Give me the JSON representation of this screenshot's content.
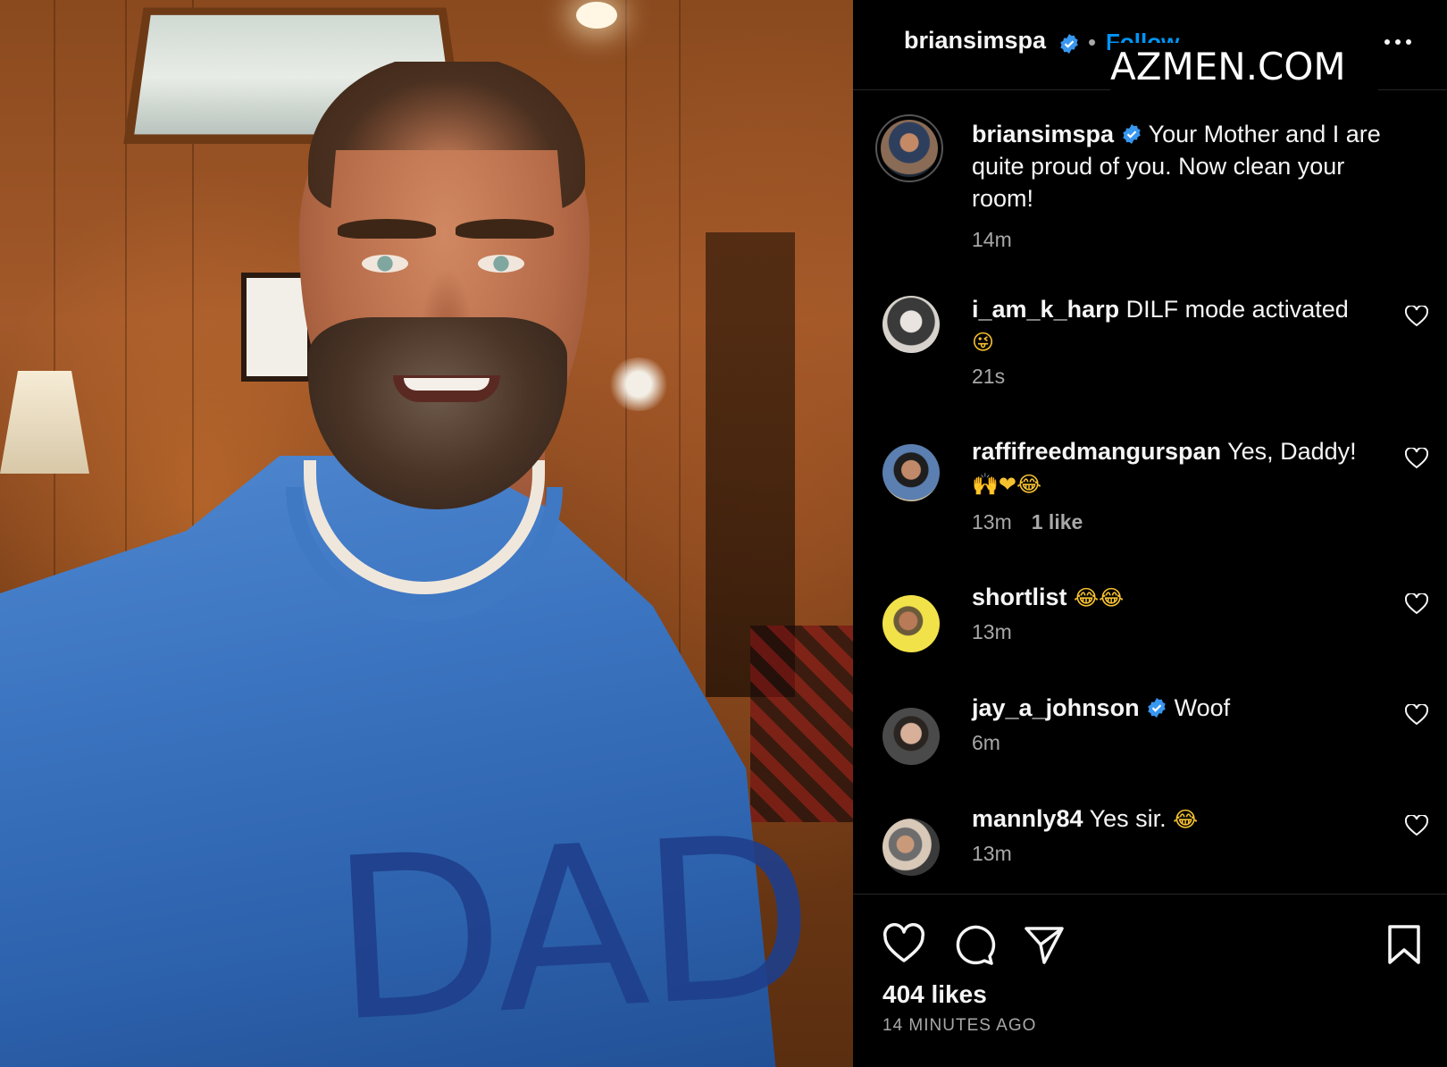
{
  "header": {
    "username": "briansimspa",
    "dot": "•",
    "follow_label": "Follow",
    "watermark": "AZMEN.COM"
  },
  "photo": {
    "sweater_text": "DAD"
  },
  "caption": {
    "username": "briansimspa",
    "text": "Your Mother and I are quite proud of you. Now clean your room!",
    "time": "14m"
  },
  "comments": [
    {
      "username": "i_am_k_harp",
      "text": "DILF mode activated",
      "emoji": "😜",
      "time": "21s",
      "likes": ""
    },
    {
      "username": "raffifreedmangurspan",
      "text": "Yes, Daddy!",
      "emoji": "🙌❤😂",
      "time": "13m",
      "likes": "1 like"
    },
    {
      "username": "shortlist",
      "text": "",
      "emoji": "😂😂",
      "time": "13m",
      "likes": ""
    },
    {
      "username": "jay_a_johnson",
      "text": "Woof",
      "emoji": "",
      "time": "6m",
      "likes": "",
      "verified": true
    },
    {
      "username": "mannly84",
      "text": "Yes sir.",
      "emoji": "😂",
      "time": "13m",
      "likes": ""
    }
  ],
  "footer": {
    "likes": "404 likes",
    "time_ago": "14 MINUTES AGO"
  },
  "colors": {
    "accent": "#0095f6",
    "verified": "#3897f0",
    "muted": "#a8a8a8",
    "background": "#000000"
  },
  "icons": [
    "verified-badge-icon",
    "more-options-icon",
    "heart-icon",
    "comment-icon",
    "share-icon",
    "bookmark-icon"
  ]
}
